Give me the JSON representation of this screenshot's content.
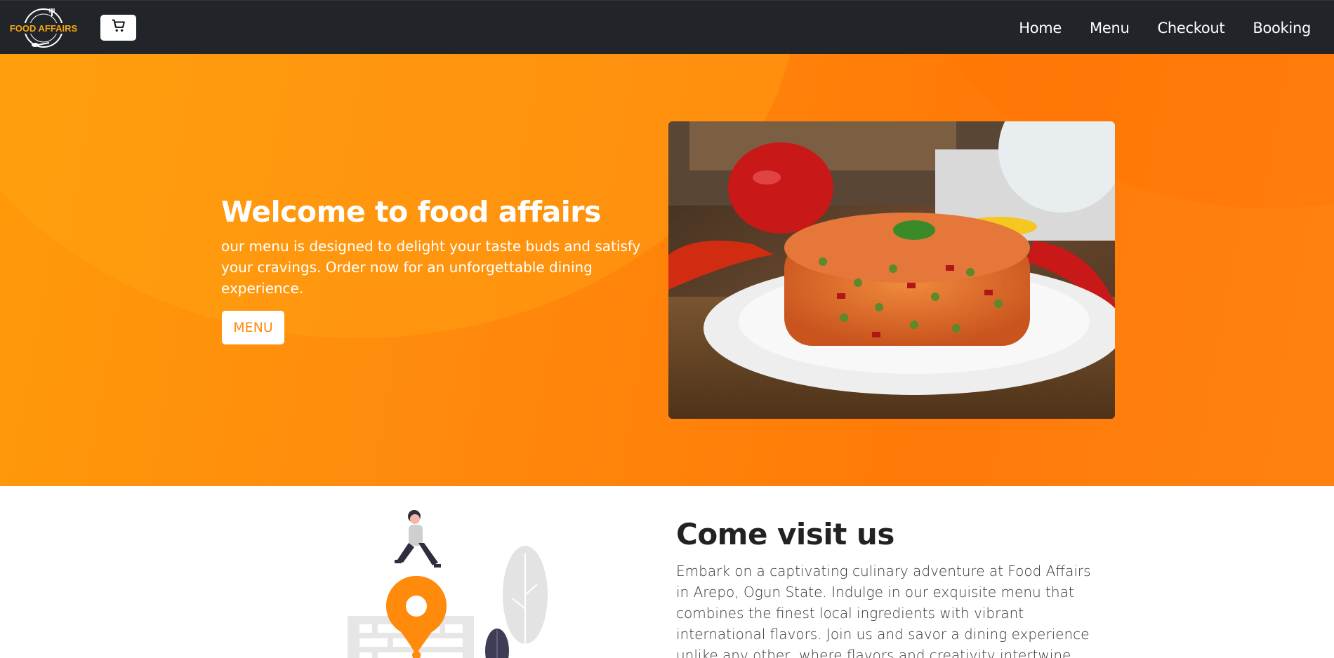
{
  "brand": {
    "logo_text": "FOOD AFFAIRS"
  },
  "nav": {
    "items": [
      {
        "label": "Home"
      },
      {
        "label": "Menu"
      },
      {
        "label": "Checkout"
      },
      {
        "label": "Booking"
      }
    ]
  },
  "icons": {
    "cart": "cart-icon"
  },
  "colors": {
    "accent": "#ff8a0c",
    "navbar": "#212529",
    "logo_gold": "#f2a516"
  },
  "hero": {
    "title": "Welcome to food affairs",
    "text": "our menu is designed to delight your taste buds and satisfy your cravings. Order now for an unforgettable dining experience.",
    "button_label": "MENU"
  },
  "visit": {
    "title": "Come visit us",
    "text": "Embark on a captivating culinary adventure at Food Affairs in Arepo, Ogun State. Indulge in our exquisite menu that combines the finest local ingredients with vibrant international flavors. Join us and savor a dining experience unlike any other, where flavors and creativity intertwine."
  }
}
